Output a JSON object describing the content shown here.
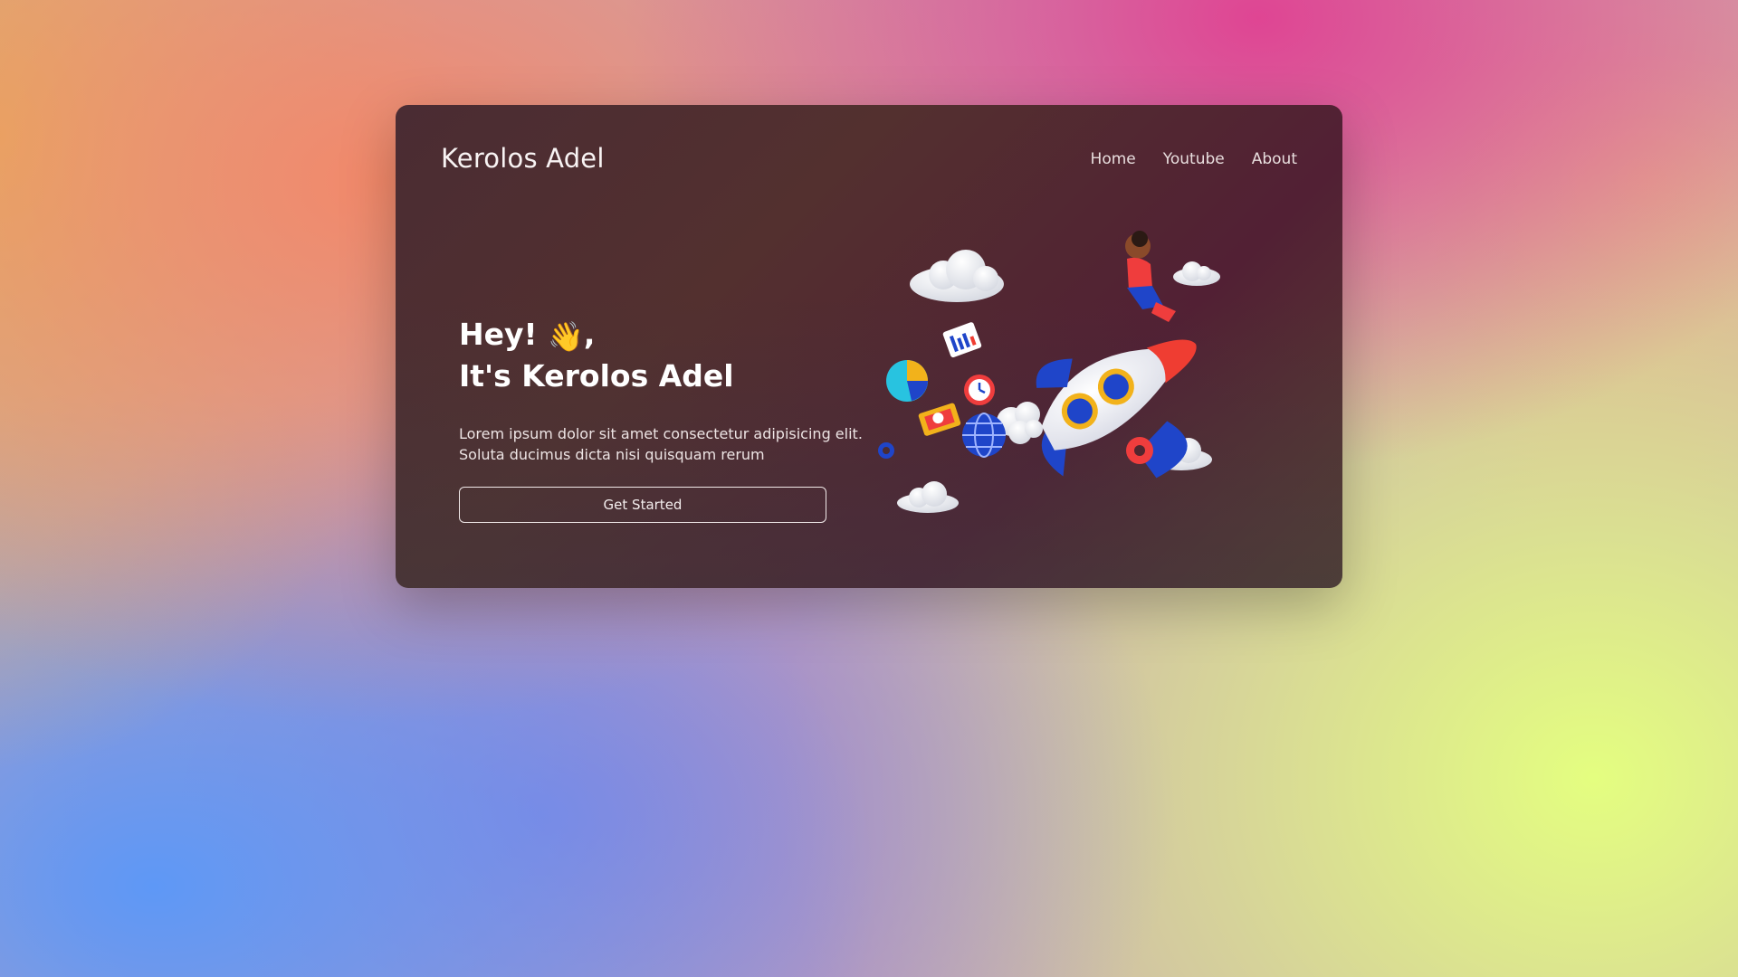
{
  "header": {
    "brand": "Kerolos Adel",
    "nav": [
      "Home",
      "Youtube",
      "About"
    ]
  },
  "hero": {
    "greeting": "Hey!",
    "greeting_suffix": ",",
    "title_line2": "It's Kerolos Adel",
    "description_line1": "Lorem ipsum dolor sit amet consectetur adipisicing elit.",
    "description_line2": "Soluta ducimus dicta nisi quisquam rerum",
    "cta_label": "Get Started"
  },
  "icons": {
    "wave": "waving-hand-icon",
    "illustration": "rocket-illustration"
  },
  "colors": {
    "card_bg": "#4f2a32",
    "text": "#f4eeee"
  }
}
